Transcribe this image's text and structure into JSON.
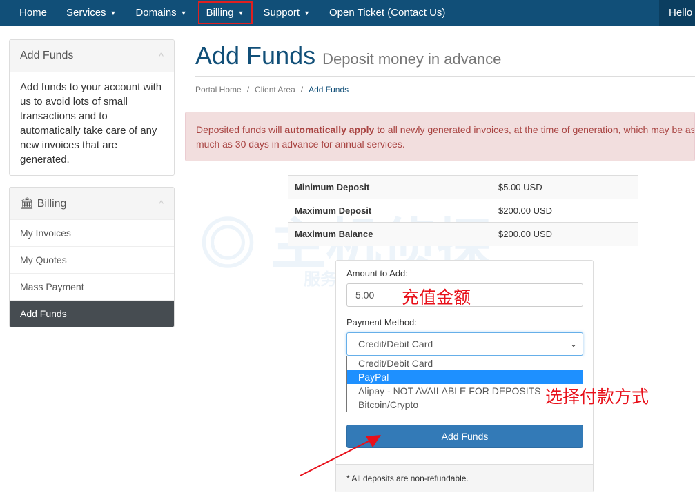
{
  "nav": {
    "items": [
      "Home",
      "Services",
      "Domains",
      "Billing",
      "Support",
      "Open Ticket (Contact Us)"
    ],
    "hello": "Hello"
  },
  "sidebar": {
    "add_funds_title": "Add Funds",
    "add_funds_text": "Add funds to your account with us to avoid lots of small transactions and to automatically take care of any new invoices that are generated.",
    "billing_title": "Billing",
    "items": [
      "My Invoices",
      "My Quotes",
      "Mass Payment",
      "Add Funds"
    ]
  },
  "page": {
    "title": "Add Funds",
    "subtitle": "Deposit money in advance",
    "breadcrumb": [
      "Portal Home",
      "Client Area",
      "Add Funds"
    ]
  },
  "alert": {
    "pre": "Deposited funds will ",
    "bold": "automatically apply",
    "post": " to all newly generated invoices, at the time of generation, which may be as",
    "line2": "much as 30 days in advance for annual services."
  },
  "limits": [
    {
      "label": "Minimum Deposit",
      "value": "$5.00 USD"
    },
    {
      "label": "Maximum Deposit",
      "value": "$200.00 USD"
    },
    {
      "label": "Maximum Balance",
      "value": "$200.00 USD"
    }
  ],
  "form": {
    "amount_label": "Amount to Add:",
    "amount_value": "5.00",
    "method_label": "Payment Method:",
    "method_selected": "Credit/Debit Card",
    "options": [
      "Credit/Debit Card",
      "PayPal",
      "Alipay - NOT AVAILABLE FOR DEPOSITS",
      "Bitcoin/Crypto"
    ],
    "highlighted_option": "PayPal",
    "submit": "Add Funds",
    "note": "* All deposits are non-refundable."
  },
  "annotations": {
    "amount": "充值金额",
    "method": "选择付款方式"
  },
  "watermark": {
    "name": "主机侦探",
    "slogan": "服务跨境电商 助力中企出海"
  },
  "colors": {
    "nav": "#114f78",
    "button": "#337ab7",
    "annotation": "#e8101a",
    "highlight": "#1e90ff"
  }
}
